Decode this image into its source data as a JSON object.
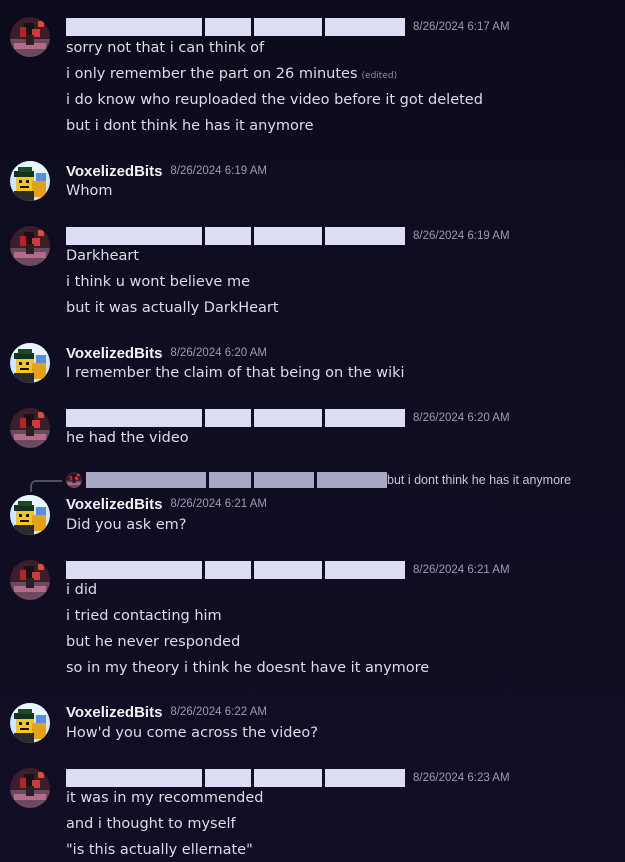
{
  "redacted_name": "redacted username",
  "voxel_name": "VoxelizedBits",
  "reply_preview": "but i dont think he has it anymore",
  "messages": [
    {
      "ts": "8/26/2024 6:17 AM",
      "l1": "sorry not that i can think of",
      "l2": "i only remember the part on 26 minutes",
      "edited": "(edited)",
      "l3": "i do know who reuploaded the video before it got deleted",
      "l4": "but i dont think he has it anymore"
    },
    {
      "ts": "8/26/2024 6:19 AM",
      "l1": "Whom"
    },
    {
      "ts": "8/26/2024 6:19 AM",
      "l1": "Darkheart",
      "l2": "i think u wont believe me",
      "l3": "but it was actually DarkHeart"
    },
    {
      "ts": "8/26/2024 6:20 AM",
      "l1": "I remember the claim of that being on the wiki"
    },
    {
      "ts": "8/26/2024 6:20 AM",
      "l1": "he had the video"
    },
    {
      "ts": "8/26/2024 6:21 AM",
      "l1": "Did you ask em?"
    },
    {
      "ts": "8/26/2024 6:21 AM",
      "l1": "i did",
      "l2": "i tried contacting him",
      "l3": "but he never responded",
      "l4": "so in my theory i think he doesnt have it anymore"
    },
    {
      "ts": "8/26/2024 6:22 AM",
      "l1": "How'd you come across the video?"
    },
    {
      "ts": "8/26/2024 6:23 AM",
      "l1": "it was in my recommended",
      "l2": "and i thought to myself",
      "l3": "\"is this actually ellernate\""
    }
  ],
  "colors": {
    "background": "#0f0d22",
    "redaction": "#dcdcf4",
    "timestamp": "#9b9bb0"
  },
  "icons": [
    "redacted-user-avatar",
    "voxelizedbits-avatar"
  ]
}
